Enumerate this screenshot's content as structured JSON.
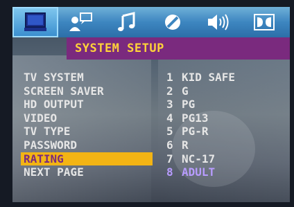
{
  "tabs": [
    {
      "icon": "monitor-icon",
      "active": true
    },
    {
      "icon": "user-chat-icon",
      "active": false
    },
    {
      "icon": "music-note-icon",
      "active": false
    },
    {
      "icon": "disc-icon",
      "active": false
    },
    {
      "icon": "speaker-icon",
      "active": false
    },
    {
      "icon": "dolby-icon",
      "active": false
    }
  ],
  "header": {
    "title": "SYSTEM SETUP"
  },
  "menu": [
    {
      "label": "TV SYSTEM"
    },
    {
      "label": "SCREEN SAVER"
    },
    {
      "label": "HD OUTPUT"
    },
    {
      "label": "VIDEO"
    },
    {
      "label": "TV TYPE"
    },
    {
      "label": "PASSWORD"
    },
    {
      "label": "RATING",
      "selected": true
    },
    {
      "label": "NEXT PAGE"
    }
  ],
  "options": [
    {
      "num": "1",
      "label": "KID SAFE"
    },
    {
      "num": "2",
      "label": "G"
    },
    {
      "num": "3",
      "label": "PG"
    },
    {
      "num": "4",
      "label": "PG13"
    },
    {
      "num": "5",
      "label": "PG-R"
    },
    {
      "num": "6",
      "label": "R"
    },
    {
      "num": "7",
      "label": "NC-17"
    },
    {
      "num": "8",
      "label": "ADULT",
      "current": true
    }
  ],
  "colors": {
    "tab_bar": "#3d86c0",
    "header_bg": "#7a2a7e",
    "header_text": "#ffd23a",
    "selected_bg": "#f3b414",
    "current_option": "#b89cff"
  }
}
